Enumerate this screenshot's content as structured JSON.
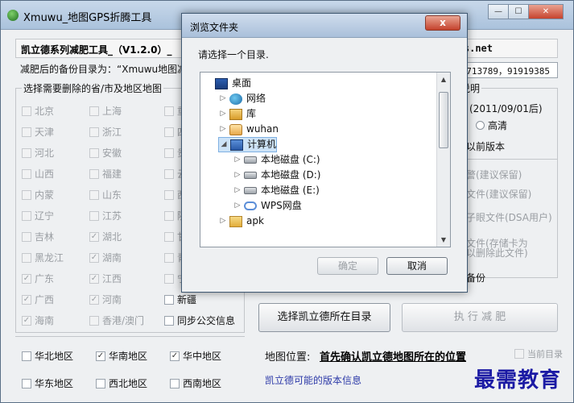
{
  "main": {
    "title": "Xmuwu_地图GPS折腾工具",
    "header_left": "凯立德系列减肥工具_（V1.2.0）_",
    "header_right": "s.net",
    "backup_label": "减肥后的备份目录为：“Xmuwu地图减",
    "contact": "73713789，91919385",
    "region_legend": "选择需要删除的省/市及地区地图",
    "provinces": [
      [
        "北京",
        "上海",
        "重"
      ],
      [
        "天津",
        "浙江",
        "四"
      ],
      [
        "河北",
        "安徽",
        "贵"
      ],
      [
        "山西",
        "福建",
        "云"
      ],
      [
        "内蒙",
        "山东",
        "西"
      ],
      [
        "辽宁",
        "江苏",
        "陕"
      ],
      [
        "吉林",
        "湖北",
        "甘"
      ],
      [
        "黑龙江",
        "湖南",
        "青"
      ],
      [
        "广东",
        "江西",
        "宁"
      ],
      [
        "广西",
        "河南",
        "新疆"
      ],
      [
        "海南",
        "香港/澳门",
        "同步公交信息"
      ]
    ],
    "areas_row1": [
      "华北地区",
      "华南地区",
      "华中地区"
    ],
    "areas_row2": [
      "华东地区",
      "西北地区",
      "西南地区"
    ],
    "right_legend": "说明",
    "right_lines": {
      "date": "(2011/09/01后)",
      "hd": "高清",
      "old": "用以前版本",
      "keep1": "预警(建议保留)",
      "keep2": "东文件(建议保留)",
      "dsa": "电子眼文件(DSA用户)",
      "store1": "眼文件(存储卡为",
      "store2": "可以删除此文件)",
      "backup": "时备份"
    },
    "btn_select_dir": "选择凯立德所在目录",
    "btn_exec": "执 行 减 肥",
    "map_pos_label": "地图位置:",
    "map_pos_link": "首先确认凯立德地图所在的位置",
    "current_dir": "当前目录",
    "versions_link": "凯立德可能的版本信息",
    "watermark": "最需教育"
  },
  "dialog": {
    "title": "浏览文件夹",
    "close": "x",
    "prompt": "请选择一个目录.",
    "tree": [
      {
        "label": "桌面",
        "icon": "desktop-icon",
        "level": 0,
        "exp": ""
      },
      {
        "label": "网络",
        "icon": "network-icon",
        "level": 1,
        "exp": "▷"
      },
      {
        "label": "库",
        "icon": "library-icon",
        "level": 1,
        "exp": "▷"
      },
      {
        "label": "wuhan",
        "icon": "user-folder-icon",
        "level": 1,
        "exp": "▷"
      },
      {
        "label": "计算机",
        "icon": "computer-icon",
        "level": 1,
        "exp": "◢"
      },
      {
        "label": "本地磁盘 (C:)",
        "icon": "disk-icon",
        "level": 2,
        "exp": "▷"
      },
      {
        "label": "本地磁盘 (D:)",
        "icon": "disk-icon",
        "level": 2,
        "exp": "▷"
      },
      {
        "label": "本地磁盘 (E:)",
        "icon": "disk-icon",
        "level": 2,
        "exp": "▷"
      },
      {
        "label": "WPS网盘",
        "icon": "cloud-icon",
        "level": 2,
        "exp": "▷"
      },
      {
        "label": "apk",
        "icon": "folder-icon",
        "level": 1,
        "exp": "▷"
      }
    ],
    "ok": "确定",
    "cancel": "取消"
  }
}
